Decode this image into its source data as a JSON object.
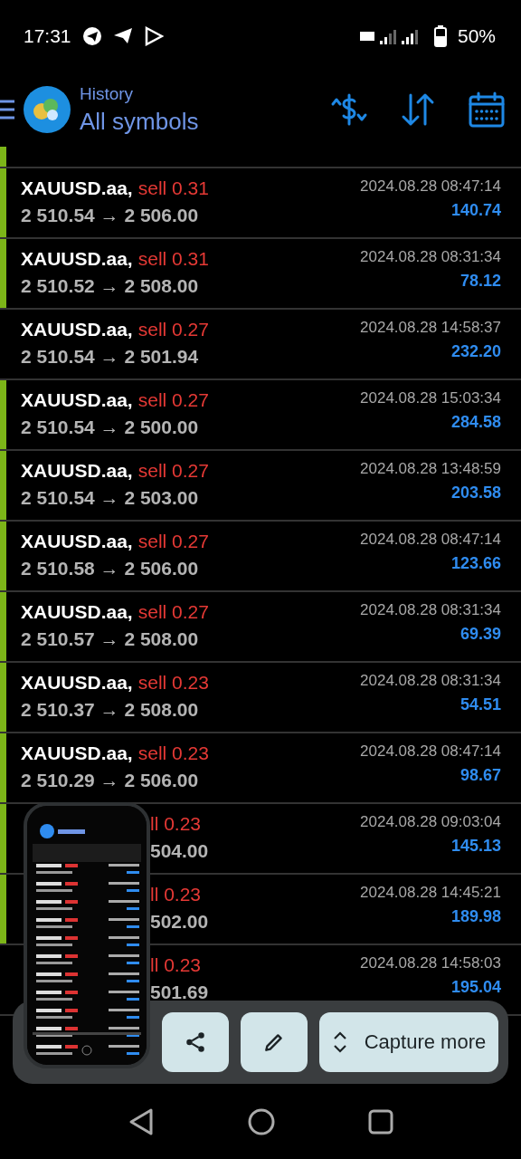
{
  "status_bar": {
    "time": "17:31",
    "battery": "50%"
  },
  "header": {
    "title": "History",
    "subtitle": "All symbols"
  },
  "top_strip": {
    "marked": true
  },
  "trades": [
    {
      "kind": "full",
      "symbol": "XAUUSD.aa,",
      "side": "sell 0.31",
      "prices": "2 510.54 → 2 506.00",
      "time": "2024.08.28 08:47:14",
      "profit": "140.74",
      "marked": true
    },
    {
      "kind": "full",
      "symbol": "XAUUSD.aa,",
      "side": "sell 0.31",
      "prices": "2 510.52 → 2 508.00",
      "time": "2024.08.28 08:31:34",
      "profit": "78.12",
      "marked": true
    },
    {
      "kind": "full",
      "symbol": "XAUUSD.aa,",
      "side": "sell 0.27",
      "prices": "2 510.54 → 2 501.94",
      "time": "2024.08.28 14:58:37",
      "profit": "232.20",
      "marked": false
    },
    {
      "kind": "full",
      "symbol": "XAUUSD.aa,",
      "side": "sell 0.27",
      "prices": "2 510.54 → 2 500.00",
      "time": "2024.08.28 15:03:34",
      "profit": "284.58",
      "marked": true
    },
    {
      "kind": "full",
      "symbol": "XAUUSD.aa,",
      "side": "sell 0.27",
      "prices": "2 510.54 → 2 503.00",
      "time": "2024.08.28 13:48:59",
      "profit": "203.58",
      "marked": true
    },
    {
      "kind": "full",
      "symbol": "XAUUSD.aa,",
      "side": "sell 0.27",
      "prices": "2 510.58 → 2 506.00",
      "time": "2024.08.28 08:47:14",
      "profit": "123.66",
      "marked": true
    },
    {
      "kind": "full",
      "symbol": "XAUUSD.aa,",
      "side": "sell 0.27",
      "prices": "2 510.57 → 2 508.00",
      "time": "2024.08.28 08:31:34",
      "profit": "69.39",
      "marked": true
    },
    {
      "kind": "full",
      "symbol": "XAUUSD.aa,",
      "side": "sell 0.23",
      "prices": "2 510.37 → 2 508.00",
      "time": "2024.08.28 08:31:34",
      "profit": "54.51",
      "marked": true
    },
    {
      "kind": "full",
      "symbol": "XAUUSD.aa,",
      "side": "sell 0.23",
      "prices": "2 510.29 → 2 506.00",
      "time": "2024.08.28 08:47:14",
      "profit": "98.67",
      "marked": true
    },
    {
      "kind": "partial",
      "side": "ll 0.23",
      "prices": "504.00",
      "time": "2024.08.28 09:03:04",
      "profit": "145.13",
      "marked": true
    },
    {
      "kind": "partial",
      "side": "ll 0.23",
      "prices": "502.00",
      "time": "2024.08.28 14:45:21",
      "profit": "189.98",
      "marked": true
    },
    {
      "kind": "partial",
      "side": "ll 0.23",
      "prices": "501.69",
      "time": "2024.08.28 14:58:03",
      "profit": "195.04",
      "marked": false
    }
  ],
  "actions": [
    {
      "kind": "share"
    },
    {
      "kind": "edit"
    },
    {
      "kind": "capture",
      "label": "Capture more"
    }
  ]
}
